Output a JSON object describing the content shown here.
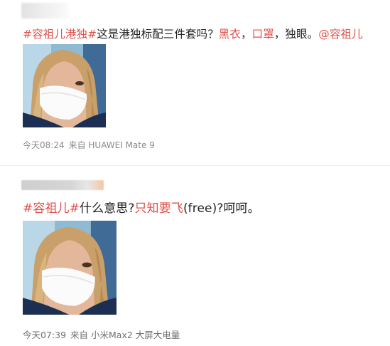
{
  "posts": [
    {
      "text_segments": [
        {
          "text": "#容祖儿港独#",
          "highlight": true
        },
        {
          "text": "这是港独标配三件套吗？",
          "highlight": false
        },
        {
          "text": "黑衣",
          "highlight": true
        },
        {
          "text": "，",
          "highlight": false
        },
        {
          "text": "口罩",
          "highlight": true
        },
        {
          "text": "，独眼。",
          "highlight": false
        },
        {
          "text": "@容祖儿",
          "highlight": true
        }
      ],
      "timestamp": "今天08:24",
      "source": "来自 HUAWEI Mate 9"
    },
    {
      "text_segments": [
        {
          "text": "#容祖儿#",
          "highlight": true
        },
        {
          "text": "什么意思?",
          "highlight": false
        },
        {
          "text": "只知要飞",
          "highlight": true
        },
        {
          "text": "(free)?呵呵。",
          "highlight": false
        }
      ],
      "timestamp": "今天07:39",
      "source": "来自 小米Max2 大屏大电量"
    }
  ],
  "colors": {
    "highlight": "#e0514b",
    "text": "#222222",
    "meta": "#8a8a8a"
  }
}
